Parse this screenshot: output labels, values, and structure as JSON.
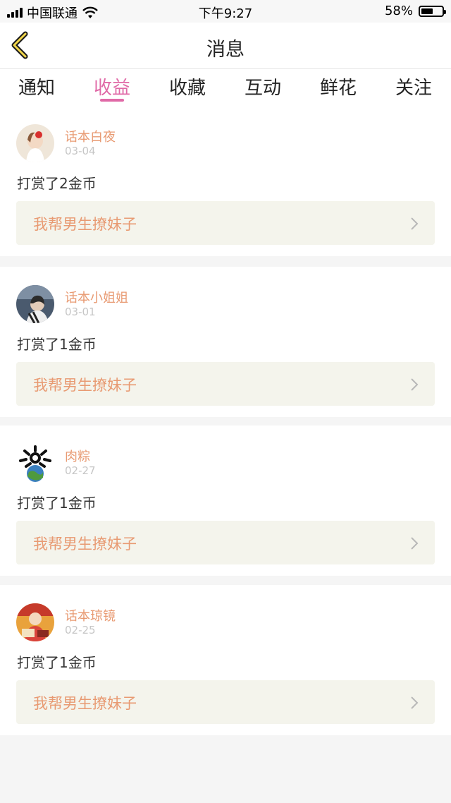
{
  "status_bar": {
    "carrier": "中国联通",
    "time": "下午9:27",
    "battery": "58%",
    "battery_level": 0.58
  },
  "nav": {
    "title": "消息"
  },
  "tabs": [
    {
      "label": "通知",
      "active": false
    },
    {
      "label": "收益",
      "active": true
    },
    {
      "label": "收藏",
      "active": false
    },
    {
      "label": "互动",
      "active": false
    },
    {
      "label": "鲜花",
      "active": false
    },
    {
      "label": "关注",
      "active": false
    }
  ],
  "messages": [
    {
      "username": "话本白夜",
      "date": "03-04",
      "text": "打赏了2金币",
      "link_title": "我帮男生撩妹子"
    },
    {
      "username": "话本小姐姐",
      "date": "03-01",
      "text": "打赏了1金币",
      "link_title": "我帮男生撩妹子"
    },
    {
      "username": "肉粽",
      "date": "02-27",
      "text": "打赏了1金币",
      "link_title": "我帮男生撩妹子"
    },
    {
      "username": "话本琼镜",
      "date": "02-25",
      "text": "打赏了1金币",
      "link_title": "我帮男生撩妹子"
    }
  ],
  "colors": {
    "accent": "#e06aa7",
    "username": "#e89a72",
    "link_bg": "#f4f4ec"
  }
}
